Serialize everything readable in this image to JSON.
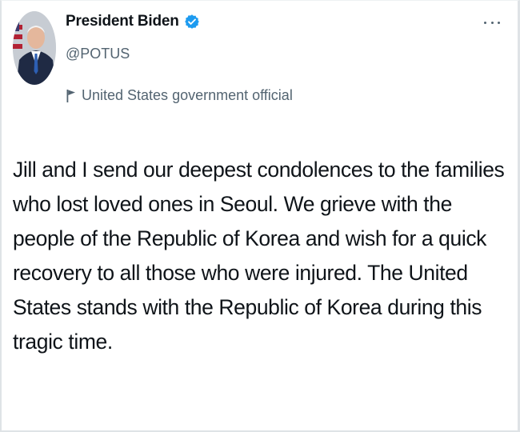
{
  "tweet": {
    "display_name": "President Biden",
    "handle": "@POTUS",
    "affiliation": "United States government official",
    "text": "Jill and I send our deepest condolences to the families\nwho lost loved ones in Seoul. We grieve with the\npeople of the Republic of Korea and wish for a quick\nrecovery to all those who were injured. The United\nStates stands with the Republic of Korea during this\ntragic time."
  },
  "icons": {
    "verified": "verified-badge-icon",
    "affiliation": "flag-icon",
    "more": "more-options-icon"
  },
  "colors": {
    "verified": "#1d9bf0",
    "text": "#0f1419",
    "secondary": "#536471"
  }
}
